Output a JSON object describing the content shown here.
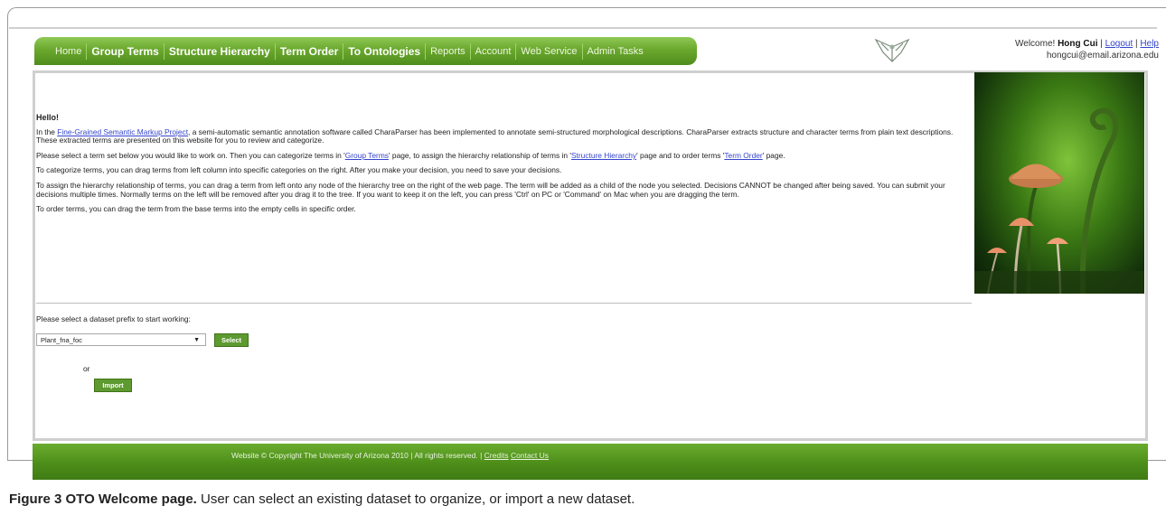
{
  "nav": {
    "items": [
      {
        "label": "Home",
        "bold": false
      },
      {
        "label": "Group Terms",
        "bold": true
      },
      {
        "label": "Structure Hierarchy",
        "bold": true
      },
      {
        "label": "Term Order",
        "bold": true
      },
      {
        "label": "To Ontologies",
        "bold": true
      },
      {
        "label": "Reports",
        "bold": false
      },
      {
        "label": "Account",
        "bold": false
      },
      {
        "label": "Web Service",
        "bold": false
      },
      {
        "label": "Admin Tasks",
        "bold": false
      }
    ]
  },
  "header": {
    "welcome_prefix": "Welcome!",
    "user_name": "Hong Cui",
    "logout_label": "Logout",
    "help_label": "Help",
    "email": "hongcui@email.arizona.edu"
  },
  "intro": {
    "hello": "Hello!",
    "p1_pre": "In the ",
    "p1_link": "Fine-Grained Semantic Markup Project",
    "p1_post": ", a semi-automatic semantic annotation software called CharaParser has been implemented to annotate semi-structured morphological descriptions. CharaParser extracts structure and character terms from plain text descriptions. These extracted terms are presented on this website for you to review and categorize.",
    "p2_a": "Please select a term set below you would like to work on. Then you can categorize terms in '",
    "p2_link1": "Group Terms",
    "p2_b": "' page, to assign the hierarchy relationship of terms in '",
    "p2_link2": "Structure Hierarchy",
    "p2_c": "' page and to order terms '",
    "p2_link3": "Term Order",
    "p2_d": "' page.",
    "p3": "To categorize terms, you can drag terms from left column into specific categories on the right. After you make your decision, you need to save your decisions.",
    "p4": "To assign the hierarchy relationship of terms, you can drag a term from left onto any node of the hierarchy tree on the right of the web page. The term will be added as a child of the node you selected. Decisions CANNOT be changed after being saved. You can submit your decisions multiple times. Normally terms on the left will be removed after you drag it to the tree. If you want to keep it on the left, you can press 'Ctrl' on PC or 'Command' on Mac when you are dragging the term.",
    "p5": "To order terms, you can drag the term from the base terms into the empty cells in specific order."
  },
  "dataset": {
    "prompt": "Please select a dataset prefix to start working:",
    "selected": "Plant_fna_foc",
    "select_button": "Select",
    "or_label": "or",
    "import_button": "Import"
  },
  "footer": {
    "copyright": "Website © Copyright The University of Arizona 2010 | All rights reserved. |",
    "credits": "Credits",
    "contact": "Contact Us"
  },
  "caption": {
    "label": "Figure 3 OTO Welcome page.",
    "text": " User can select an existing dataset to organize, or import a new dataset."
  },
  "icons": {
    "logo": "oto-logo-icon",
    "dropdown": "chevron-down-icon"
  },
  "colors": {
    "nav_green": "#6aa82e",
    "footer_green": "#4d8e1a",
    "link": "#3344cc",
    "button": "#5d9a30"
  }
}
